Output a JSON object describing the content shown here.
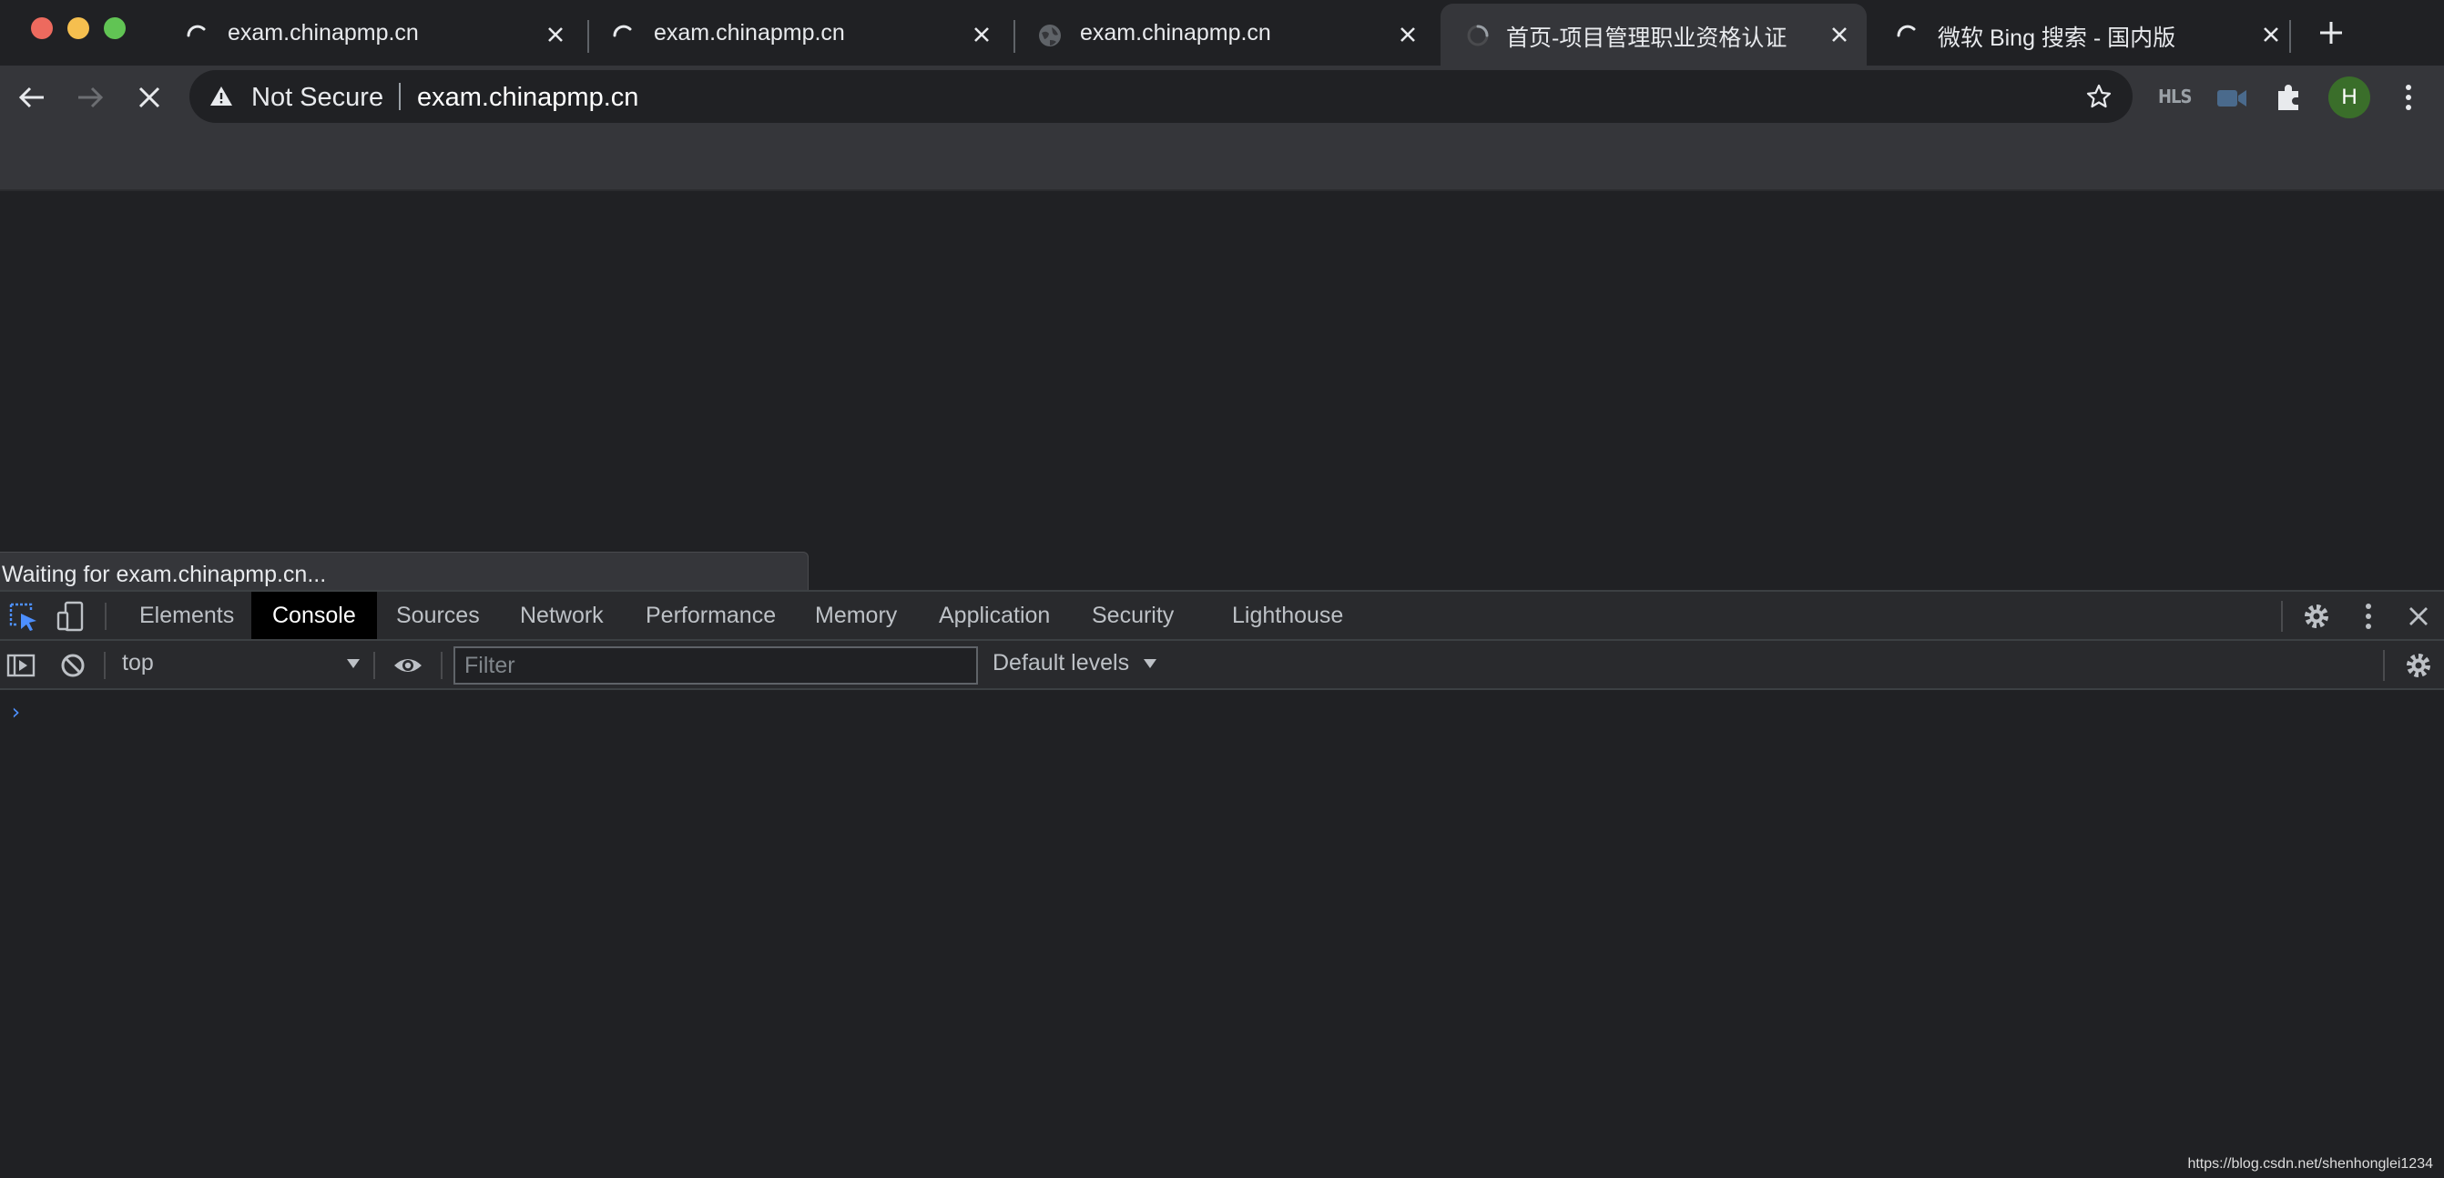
{
  "tabs": [
    {
      "title": "exam.chinapmp.cn",
      "state": "loading"
    },
    {
      "title": "exam.chinapmp.cn",
      "state": "loading"
    },
    {
      "title": "exam.chinapmp.cn",
      "state": "globe"
    },
    {
      "title": "首页-项目管理职业资格认证",
      "state": "loading",
      "active": true
    },
    {
      "title": "微软 Bing 搜索 - 国内版",
      "state": "loading"
    }
  ],
  "omnibox": {
    "security_label": "Not Secure",
    "url": "exam.chinapmp.cn"
  },
  "toolbar": {
    "hls_label": "HLS",
    "avatar_letter": "H",
    "avatar_color": "#3a6e2a"
  },
  "status_bubble": "Waiting for exam.chinapmp.cn...",
  "devtools": {
    "tabs": [
      "Elements",
      "Console",
      "Sources",
      "Network",
      "Performance",
      "Memory",
      "Application",
      "Security",
      "Lighthouse"
    ],
    "active_tab": "Console",
    "context": "top",
    "filter_placeholder": "Filter",
    "levels_label": "Default levels",
    "prompt_symbol": "›"
  },
  "watermark": "https://blog.csdn.net/shenhonglei1234",
  "colors": {
    "accent": "#4d8fff",
    "traffic_red": "#ed6a5e",
    "traffic_yellow": "#f5bf4f",
    "traffic_green": "#61c454"
  }
}
